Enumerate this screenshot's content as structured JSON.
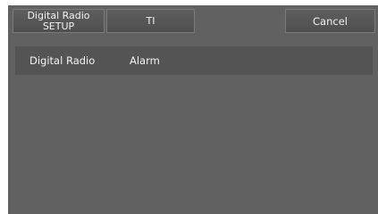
{
  "toolbar": {
    "setup_line1": "Digital Radio",
    "setup_line2": "SETUP",
    "ti_label": "TI",
    "cancel_label": "Cancel"
  },
  "list": {
    "items": [
      {
        "label": "Digital Radio",
        "value": "Alarm"
      }
    ]
  }
}
